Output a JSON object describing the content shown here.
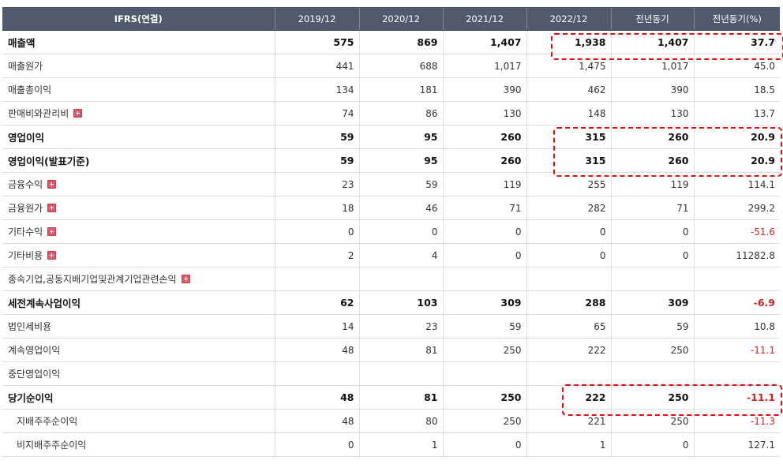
{
  "header": {
    "title": "IFRS(연결)",
    "years": [
      "2019/12",
      "2020/12",
      "2021/12",
      "2022/12"
    ],
    "yoy": "전년동기",
    "yoy_pct": "전년동기(%)"
  },
  "rows": [
    {
      "label": "매출액",
      "bold": true,
      "indent": false,
      "expandable": false,
      "values": [
        "575",
        "869",
        "1,407",
        "1,938",
        "1,407",
        "37.7"
      ],
      "negative": false
    },
    {
      "label": "매출원가",
      "bold": false,
      "indent": false,
      "expandable": false,
      "values": [
        "441",
        "688",
        "1,017",
        "1,475",
        "1,017",
        "45.0"
      ],
      "negative": false
    },
    {
      "label": "매출총이익",
      "bold": false,
      "indent": false,
      "expandable": false,
      "values": [
        "134",
        "181",
        "390",
        "462",
        "390",
        "18.5"
      ],
      "negative": false
    },
    {
      "label": "판매비와관리비",
      "bold": false,
      "indent": false,
      "expandable": true,
      "values": [
        "74",
        "86",
        "130",
        "148",
        "130",
        "13.7"
      ],
      "negative": false
    },
    {
      "label": "영업이익",
      "bold": true,
      "indent": false,
      "expandable": false,
      "values": [
        "59",
        "95",
        "260",
        "315",
        "260",
        "20.9"
      ],
      "negative": false
    },
    {
      "label": "영업이익(발표기준)",
      "bold": true,
      "indent": false,
      "expandable": false,
      "values": [
        "59",
        "95",
        "260",
        "315",
        "260",
        "20.9"
      ],
      "negative": false
    },
    {
      "label": "금융수익",
      "bold": false,
      "indent": false,
      "expandable": true,
      "values": [
        "23",
        "59",
        "119",
        "255",
        "119",
        "114.1"
      ],
      "negative": false
    },
    {
      "label": "금융원가",
      "bold": false,
      "indent": false,
      "expandable": true,
      "values": [
        "18",
        "46",
        "71",
        "282",
        "71",
        "299.2"
      ],
      "negative": false
    },
    {
      "label": "기타수익",
      "bold": false,
      "indent": false,
      "expandable": true,
      "values": [
        "0",
        "0",
        "0",
        "0",
        "0",
        "-51.6"
      ],
      "negative": true
    },
    {
      "label": "기타비용",
      "bold": false,
      "indent": false,
      "expandable": true,
      "values": [
        "2",
        "4",
        "0",
        "0",
        "0",
        "11282.8"
      ],
      "negative": false
    },
    {
      "label": "종속기업,공동지배기업및관계기업관련손익",
      "bold": false,
      "indent": false,
      "expandable": true,
      "values": [
        "",
        "",
        "",
        "",
        "",
        ""
      ],
      "negative": false
    },
    {
      "label": "세전계속사업이익",
      "bold": true,
      "indent": false,
      "expandable": false,
      "values": [
        "62",
        "103",
        "309",
        "288",
        "309",
        "-6.9"
      ],
      "negative": true
    },
    {
      "label": "법인세비용",
      "bold": false,
      "indent": false,
      "expandable": false,
      "values": [
        "14",
        "23",
        "59",
        "65",
        "59",
        "10.8"
      ],
      "negative": false
    },
    {
      "label": "계속영업이익",
      "bold": false,
      "indent": false,
      "expandable": false,
      "values": [
        "48",
        "81",
        "250",
        "222",
        "250",
        "-11.1"
      ],
      "negative": true
    },
    {
      "label": "중단영업이익",
      "bold": false,
      "indent": false,
      "expandable": false,
      "values": [
        "",
        "",
        "",
        "",
        "",
        ""
      ],
      "negative": false
    },
    {
      "label": "당기순이익",
      "bold": true,
      "indent": false,
      "expandable": false,
      "values": [
        "48",
        "81",
        "250",
        "222",
        "250",
        "-11.1"
      ],
      "negative": true
    },
    {
      "label": "지배주주순이익",
      "bold": false,
      "indent": true,
      "expandable": false,
      "values": [
        "48",
        "80",
        "250",
        "221",
        "250",
        "-11.3"
      ],
      "negative": true
    },
    {
      "label": "비지배주주순이익",
      "bold": false,
      "indent": true,
      "expandable": false,
      "values": [
        "0",
        "1",
        "0",
        "1",
        "0",
        "127.1"
      ],
      "negative": false
    }
  ],
  "colors": {
    "header_bg": "#505a6c",
    "negative": "#d42020",
    "highlight": "#e01010",
    "expand_icon": "#e0576a"
  }
}
